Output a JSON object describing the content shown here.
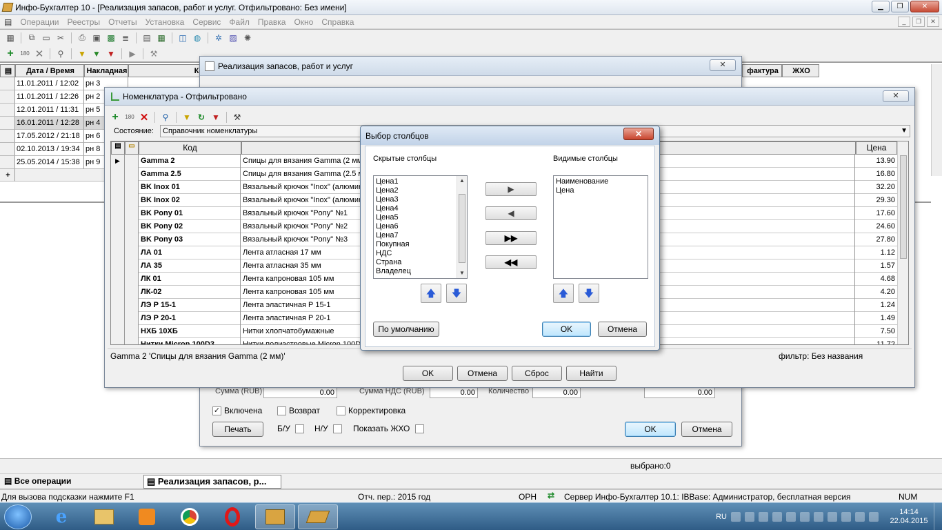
{
  "app": {
    "title": "Инфо-Бухгалтер 10 - [Реализация запасов, работ и услуг.   Отфильтровано: Без имени]"
  },
  "menu": [
    "Операции",
    "Реестры",
    "Отчеты",
    "Установка",
    "Сервис",
    "Файл",
    "Правка",
    "Окно",
    "Справка"
  ],
  "bg_table": {
    "headers": {
      "date": "Дата / Время",
      "invoice": "Накладная",
      "ko": "Ко",
      "facture": "фактура",
      "zho": "ЖХО"
    },
    "rows": [
      {
        "date": "11.01.2011 / 12:02",
        "inv": "рн 3"
      },
      {
        "date": "11.01.2011 / 12:26",
        "inv": "рн 2"
      },
      {
        "date": "12.01.2011 / 11:31",
        "inv": "рн 5"
      },
      {
        "date": "16.01.2011 / 12:28",
        "inv": "рн 4"
      },
      {
        "date": "17.05.2012 / 21:18",
        "inv": "рн 6"
      },
      {
        "date": "02.10.2013 / 19:34",
        "inv": "рн 8"
      },
      {
        "date": "25.05.2014 / 15:38",
        "inv": "рн 9"
      }
    ],
    "add": "+"
  },
  "realization": {
    "title": "Реализация запасов, работ и услуг",
    "sum_label": "Сумма (RUB)",
    "sum_value": "0.00",
    "vat_label": "Сумма НДС (RUB)",
    "vat_value": "0.00",
    "qty_label": "Количество",
    "qty_value": "0.00",
    "extra_value": "0.00",
    "enabled": "Включена",
    "return": "Возврат",
    "correction": "Корректировка",
    "print": "Печать",
    "bu": "Б/У",
    "nu": "Н/У",
    "show_zho": "Показать ЖХО",
    "ok": "OK",
    "cancel": "Отмена"
  },
  "nomen": {
    "title": "Номенклатура - Отфильтровано",
    "state_label": "Состояние:",
    "state_value": "Справочник номенклатуры",
    "col_code": "Код",
    "col_price": "Цена",
    "rows": [
      {
        "code": "Gamma 2",
        "name": "Спицы для вязания Gamma (2 мм)",
        "price": "13.90"
      },
      {
        "code": "Gamma 2.5",
        "name": "Спицы для вязания Gamma (2.5 мм)",
        "price": "16.80"
      },
      {
        "code": "BK Inox 01",
        "name": "Вязальный крючок \"Inox\" (алюминий)",
        "price": "32.20"
      },
      {
        "code": "BK Inox 02",
        "name": "Вязальный крючок \"Inox\" (алюминий)",
        "price": "29.30"
      },
      {
        "code": "BK Pony 01",
        "name": "Вязальный крючок \"Pony\" №1",
        "price": "17.60"
      },
      {
        "code": "BK Pony 02",
        "name": "Вязальный крючок \"Pony\" №2",
        "price": "24.60"
      },
      {
        "code": "BK Pony 03",
        "name": "Вязальный крючок \"Pony\" №3",
        "price": "27.80"
      },
      {
        "code": "ЛА 01",
        "name": "Лента атласная 17 мм",
        "price": "1.12"
      },
      {
        "code": "ЛА 35",
        "name": "Лента атласная 35 мм",
        "price": "1.57"
      },
      {
        "code": "ЛК 01",
        "name": "Лента капроновая 105 мм",
        "price": "4.68"
      },
      {
        "code": "ЛК-02",
        "name": "Лента капроновая 105 мм",
        "price": "4.20"
      },
      {
        "code": "ЛЭ Р 15-1",
        "name": "Лента эластичная Р 15-1",
        "price": "1.24"
      },
      {
        "code": "ЛЭ Р 20-1",
        "name": "Лента эластичная Р 20-1",
        "price": "1.49"
      },
      {
        "code": "НХБ 10ХБ",
        "name": "Нитки хлопчатобумажные",
        "price": "7.50"
      },
      {
        "code": "Нитки Micron 100D3",
        "name": "Нитки полиэстровые Micron 100D",
        "price": "11.72"
      }
    ],
    "status_left": "Gamma 2 'Спицы для вязания Gamma (2 мм)'",
    "status_right": "фильтр: Без названия",
    "ok": "OK",
    "cancel": "Отмена",
    "reset": "Сброс",
    "find": "Найти"
  },
  "dialog": {
    "title": "Выбор столбцов",
    "hidden_label": "Скрытые столбцы",
    "visible_label": "Видимые столбцы",
    "hidden": [
      "Цена1",
      "Цена2",
      "Цена3",
      "Цена4",
      "Цена5",
      "Цена6",
      "Цена7",
      "Покупная",
      "НДС",
      "Страна",
      "Владелец"
    ],
    "visible": [
      "Наименование",
      "Цена"
    ],
    "default_btn": "По умолчанию",
    "ok": "OK",
    "cancel": "Отмена"
  },
  "bottom": {
    "selected": "выбрано:0",
    "tab1": "Все операции",
    "tab2": "Реализация запасов, р...",
    "hint": "Для вызова подсказки нажмите F1",
    "period": "Отч. пер.: 2015 год",
    "orn": "ОРН",
    "server": "Сервер Инфо-Бухгалтер 10.1: IBBase: Администратор, бесплатная версия",
    "num": "NUM"
  },
  "tray": {
    "lang": "RU",
    "time": "14:14",
    "date": "22.04.2015"
  }
}
